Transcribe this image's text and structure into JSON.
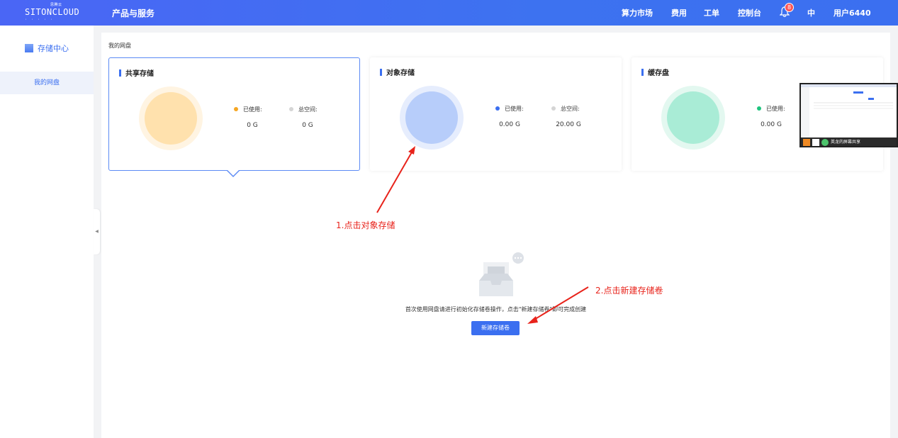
{
  "topbar": {
    "logo": "SITONCLOUD",
    "logo_sub": "思腾云",
    "nav_products": "产品与服务",
    "items": [
      "算力市场",
      "费用",
      "工单",
      "控制台"
    ],
    "notification_count": "8",
    "language": "中",
    "user": "用户6440"
  },
  "sidebar": {
    "title": "存储中心",
    "items": [
      {
        "label": "我的网盘"
      }
    ]
  },
  "main": {
    "breadcrumb": "我的网盘",
    "cards": [
      {
        "title": "共享存储",
        "used_label": "已使用:",
        "total_label": "总空间:",
        "used": "0 G",
        "total": "0 G",
        "color": "#ffe1ad"
      },
      {
        "title": "对象存储",
        "used_label": "已使用:",
        "total_label": "总空间:",
        "used": "0.00 G",
        "total": "20.00 G",
        "color": "#b7cdfa"
      },
      {
        "title": "缓存盘",
        "used_label": "已使用:",
        "used": "0.00 G",
        "color": "#a9ecd6"
      }
    ],
    "empty_text": "首次使用网盘请进行初始化存储卷操作，点击\"新建存储卷\"即可完成创建",
    "new_button": "新建存储卷"
  },
  "annotations": {
    "step1": "1.点击对象存储",
    "step2": "2.点击新建存储卷"
  },
  "screen_share": {
    "label": "英龙的屏幕共享"
  }
}
